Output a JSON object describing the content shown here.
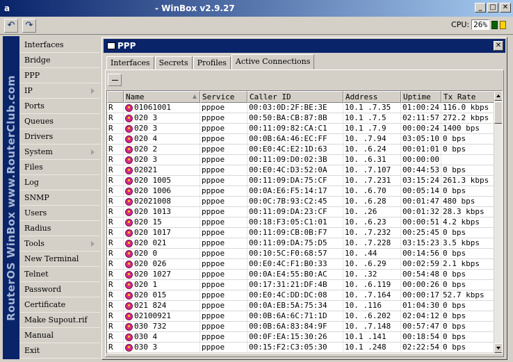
{
  "window": {
    "title": "a                                                  - WinBox v2.9.27",
    "minimize": "_",
    "maximize": "□",
    "close": "✕"
  },
  "toolbar": {
    "undo_icon": "↶",
    "redo_icon": "↷",
    "cpu_label": "CPU:",
    "cpu_value": "26%"
  },
  "brand": {
    "text": "RouterOS WinBox   www.RouterClub.com"
  },
  "menu": [
    {
      "label": "Interfaces",
      "submenu": false
    },
    {
      "label": "Bridge",
      "submenu": false
    },
    {
      "label": "PPP",
      "submenu": false
    },
    {
      "label": "IP",
      "submenu": true
    },
    {
      "label": "Ports",
      "submenu": false
    },
    {
      "label": "Queues",
      "submenu": false
    },
    {
      "label": "Drivers",
      "submenu": false
    },
    {
      "label": "System",
      "submenu": true
    },
    {
      "label": "Files",
      "submenu": false
    },
    {
      "label": "Log",
      "submenu": false
    },
    {
      "label": "SNMP",
      "submenu": false
    },
    {
      "label": "Users",
      "submenu": false
    },
    {
      "label": "Radius",
      "submenu": false
    },
    {
      "label": "Tools",
      "submenu": true
    },
    {
      "label": "New Terminal",
      "submenu": false
    },
    {
      "label": "Telnet",
      "submenu": false
    },
    {
      "label": "Password",
      "submenu": false
    },
    {
      "label": "Certificate",
      "submenu": false
    },
    {
      "label": "Make Supout.rif",
      "submenu": false
    },
    {
      "label": "Manual",
      "submenu": false
    },
    {
      "label": "Exit",
      "submenu": false
    }
  ],
  "ppp": {
    "title": "PPP",
    "close": "✕",
    "tabs": [
      "Interfaces",
      "Secrets",
      "Profiles",
      "Active Connections"
    ],
    "active_tab": 3,
    "columns": [
      "",
      "Name",
      "Service",
      "Caller ID",
      "Address",
      "Uptime",
      "Tx Rate"
    ],
    "rows": [
      [
        "R",
        "01061001",
        "pppoe",
        "00:03:0D:2F:BE:3E",
        "10.1  .7.35",
        "01:00:24",
        "116.0 kbps"
      ],
      [
        "R",
        "020  3",
        "pppoe",
        "00:50:BA:CB:87:8B",
        "10.1  .7.5",
        "02:11:57",
        "272.2 kbps"
      ],
      [
        "R",
        "020  3",
        "pppoe",
        "00:11:09:82:CA:C1",
        "10.1  .7.9",
        "00:00:24",
        "1400 bps"
      ],
      [
        "R",
        "020  4",
        "pppoe",
        "00:0B:6A:46:EC:FF",
        "10.  .7.94",
        "03:05:10",
        "0 bps"
      ],
      [
        "R",
        "020  2",
        "pppoe",
        "00:E0:4C:E2:1D:63",
        "10.  .6.24",
        "00:01:01",
        "0 bps"
      ],
      [
        "R",
        "020  3",
        "pppoe",
        "00:11:09:D0:02:3B",
        "10.  .6.31",
        "00:00:00",
        ""
      ],
      [
        "R",
        "02021",
        "pppoe",
        "00:E0:4C:D3:52:0A",
        "10.  .7.107",
        "00:44:53",
        "0 bps"
      ],
      [
        "R",
        "020 1005",
        "pppoe",
        "00:11:09:DA:75:CF",
        "10.  .7.231",
        "03:15:24",
        "261.3 kbps"
      ],
      [
        "R",
        "020 1006",
        "pppoe",
        "00:0A:E6:F5:14:17",
        "10.  .6.70",
        "00:05:14",
        "0 bps"
      ],
      [
        "R",
        "02021008",
        "pppoe",
        "00:0C:7B:93:C2:45",
        "10.  .6.28",
        "00:01:47",
        "480 bps"
      ],
      [
        "R",
        "020 1013",
        "pppoe",
        "00:11:09:DA:23:CF",
        "10.  .26",
        "00:01:32",
        "28.3 kbps"
      ],
      [
        "R",
        "020  15",
        "pppoe",
        "00:18:F3:05:C1:01",
        "10.  .6.23",
        "00:00:51",
        "4.2 kbps"
      ],
      [
        "R",
        "020 1017",
        "pppoe",
        "00:11:09:CB:0B:F7",
        "10.  .7.232",
        "00:25:45",
        "0 bps"
      ],
      [
        "R",
        "020  021",
        "pppoe",
        "00:11:09:DA:75:D5",
        "10.  .7.228",
        "03:15:23",
        "3.5 kbps"
      ],
      [
        "R",
        "020  0",
        "pppoe",
        "00:10:5C:F0:68:57",
        "10.  .44",
        "00:14:56",
        "0 bps"
      ],
      [
        "R",
        "020  026",
        "pppoe",
        "00:E0:4C:F1:B0:33",
        "10.  .6.29",
        "00:02:59",
        "2.1 kbps"
      ],
      [
        "R",
        "020 1027",
        "pppoe",
        "00:0A:E4:55:B0:AC",
        "10.  .32",
        "00:54:48",
        "0 bps"
      ],
      [
        "R",
        "020  1",
        "pppoe",
        "00:17:31:21:DF:4B",
        "10.  .6.119",
        "00:00:26",
        "0 bps"
      ],
      [
        "R",
        "020  015",
        "pppoe",
        "00:E0:4C:DD:DC:08",
        "10.  .7.164",
        "00:00:17",
        "52.7 kbps"
      ],
      [
        "R",
        "021  824",
        "pppoe",
        "00:0A:EB:5A:75:34",
        "10.  .116",
        "01:04:30",
        "0 bps"
      ],
      [
        "R",
        "02100921",
        "pppoe",
        "00:0B:6A:6C:71:1D",
        "10.  .6.202",
        "02:04:12",
        "0 bps"
      ],
      [
        "R",
        "030  732",
        "pppoe",
        "00:0B:6A:83:84:9F",
        "10.  .7.148",
        "00:57:47",
        "0 bps"
      ],
      [
        "R",
        "030  4",
        "pppoe",
        "00:0F:EA:15:30:26",
        "10.1  .141",
        "00:18:54",
        "0 bps"
      ],
      [
        "R",
        "030  3",
        "pppoe",
        "00:15:F2:C3:05:30",
        "10.1  .248",
        "02:22:54",
        "0 bps"
      ]
    ]
  },
  "colors": {
    "titlebar": "#0a246a",
    "face": "#d4d0c8",
    "brand_strip": "#0a246a",
    "user_icon": "#d52b8a"
  }
}
